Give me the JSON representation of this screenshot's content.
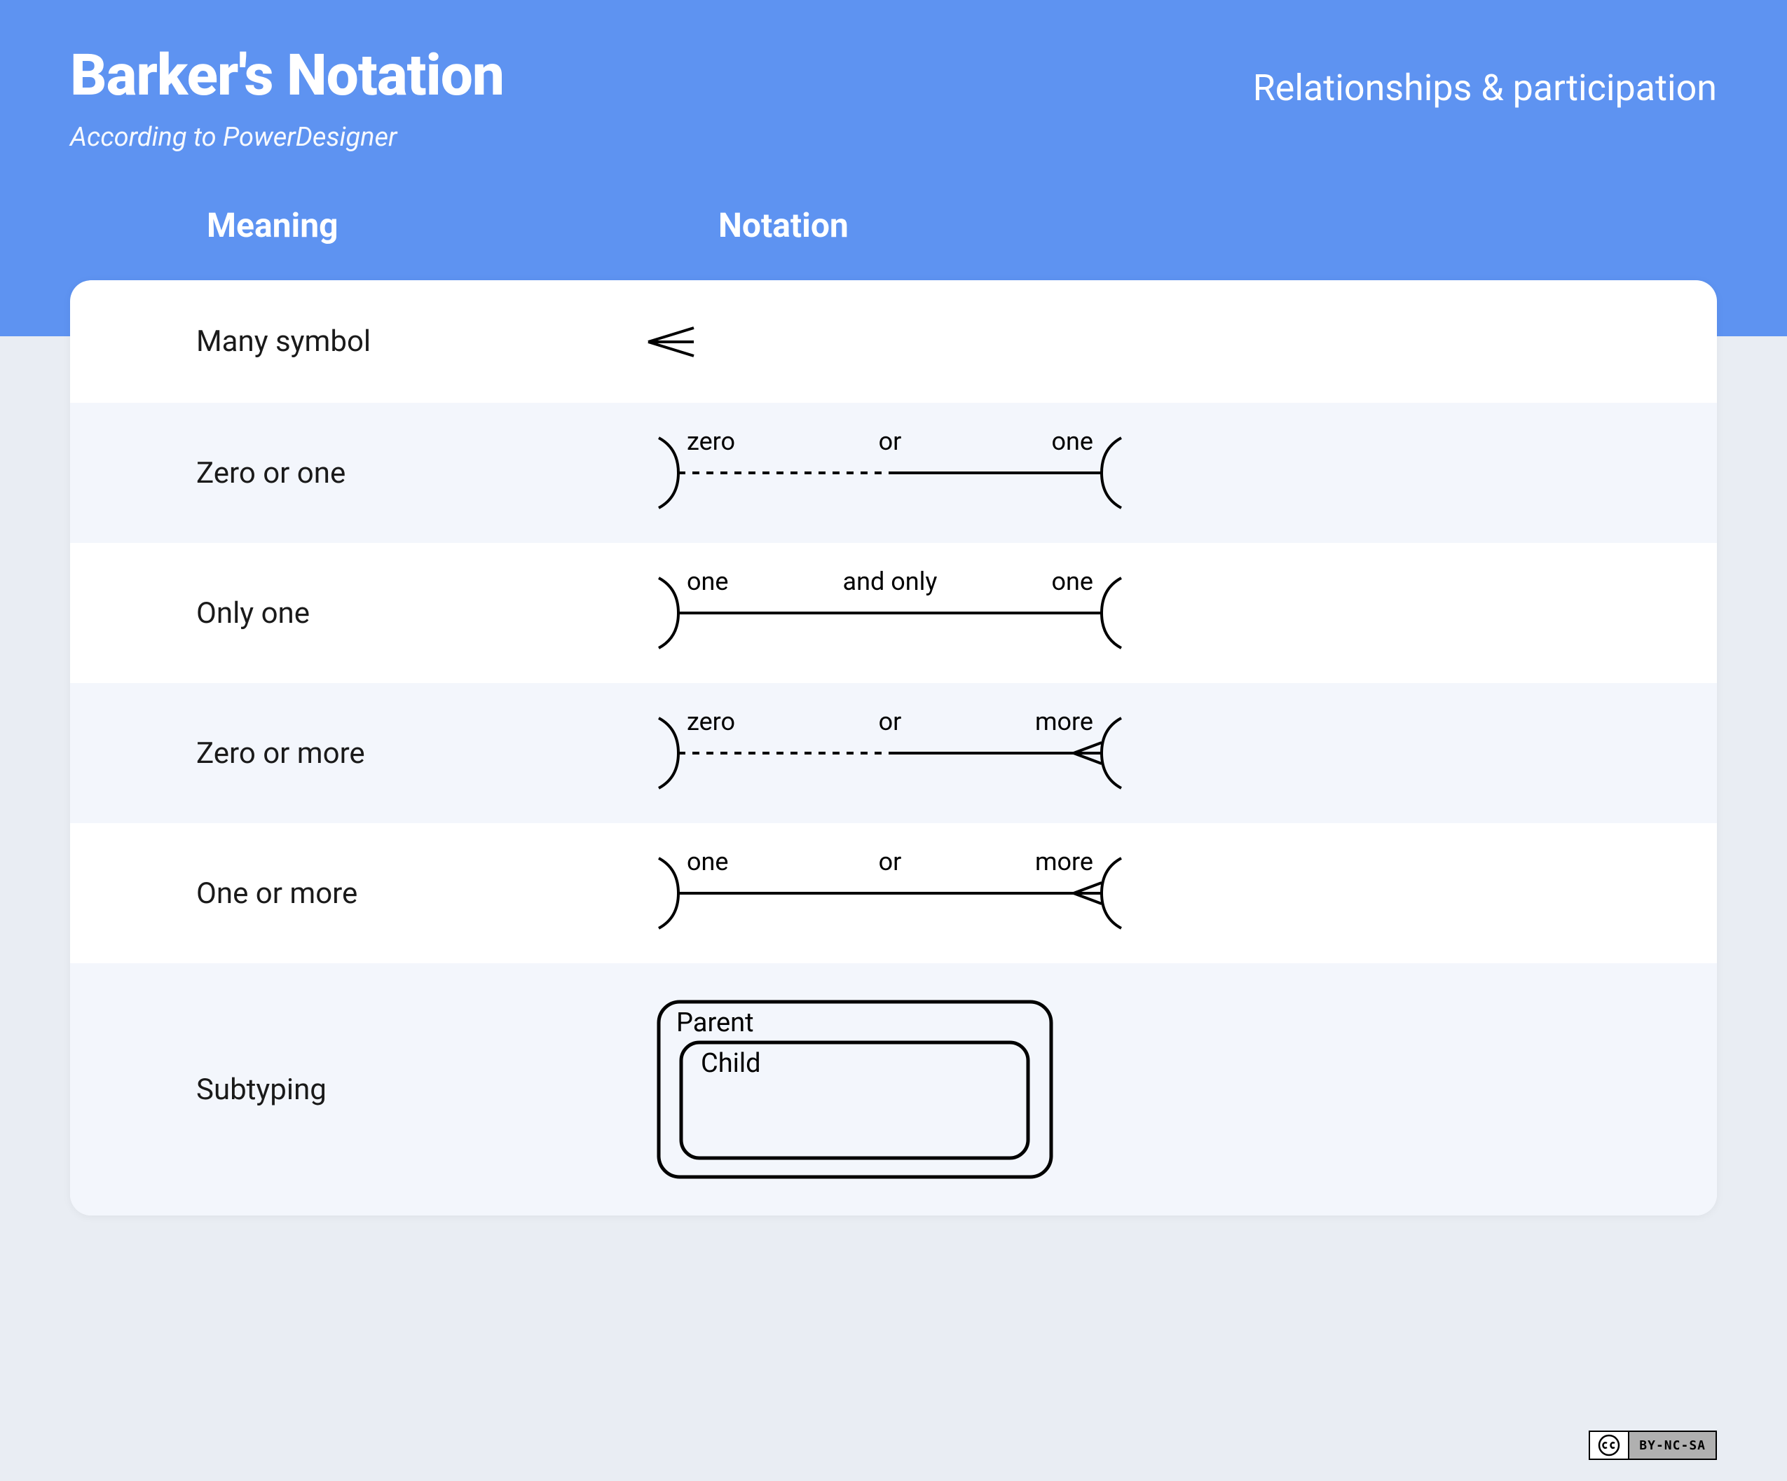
{
  "header": {
    "title": "Barker's Notation",
    "subtitle": "According to PowerDesigner",
    "topic": "Relationships & participation"
  },
  "columns": {
    "meaning": "Meaning",
    "notation": "Notation"
  },
  "rows": {
    "many": {
      "meaning": "Many symbol"
    },
    "zero_one": {
      "meaning": "Zero or one",
      "labels": {
        "l": "zero",
        "m": "or",
        "r": "one"
      }
    },
    "only_one": {
      "meaning": "Only one",
      "labels": {
        "l": "one",
        "m": "and only",
        "r": "one"
      }
    },
    "zero_more": {
      "meaning": "Zero or more",
      "labels": {
        "l": "zero",
        "m": "or",
        "r": "more"
      }
    },
    "one_more": {
      "meaning": "One or more",
      "labels": {
        "l": "one",
        "m": "or",
        "r": "more"
      }
    },
    "subtyping": {
      "meaning": "Subtyping",
      "parent": "Parent",
      "child": "Child"
    }
  },
  "license": "BY-NC-SA"
}
